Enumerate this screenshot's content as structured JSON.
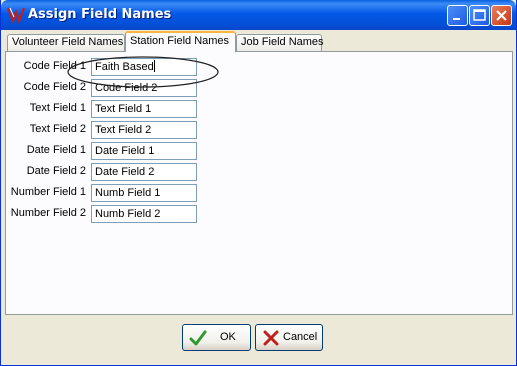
{
  "window": {
    "title": "Assign Field Names"
  },
  "tabs": [
    {
      "label": "Volunteer Field Names",
      "active": false
    },
    {
      "label": "Station Field Names",
      "active": true
    },
    {
      "label": "Job Field Names",
      "active": false
    }
  ],
  "fields": [
    {
      "label": "Code Field 1",
      "value": "Faith Based"
    },
    {
      "label": "Code Field 2",
      "value": "Code Field 2"
    },
    {
      "label": "Text Field 1",
      "value": "Text Field 1"
    },
    {
      "label": "Text Field 2",
      "value": "Text Field 2"
    },
    {
      "label": "Date Field 1",
      "value": "Date Field 1"
    },
    {
      "label": "Date Field 2",
      "value": "Date Field 2"
    },
    {
      "label": "Number Field 1",
      "value": "Numb Field 1"
    },
    {
      "label": "Number Field 2",
      "value": "Numb Field 2"
    }
  ],
  "buttons": {
    "ok_label": "OK",
    "cancel_label": "Cancel"
  },
  "colors": {
    "titlebar": "#0458e8",
    "accent_tab": "#f7b641",
    "ok_check": "#2f9a2f",
    "cancel_x": "#c0201b"
  },
  "icons": {
    "app": "app-logo-icon",
    "ok": "checkmark-icon",
    "cancel": "x-icon"
  }
}
